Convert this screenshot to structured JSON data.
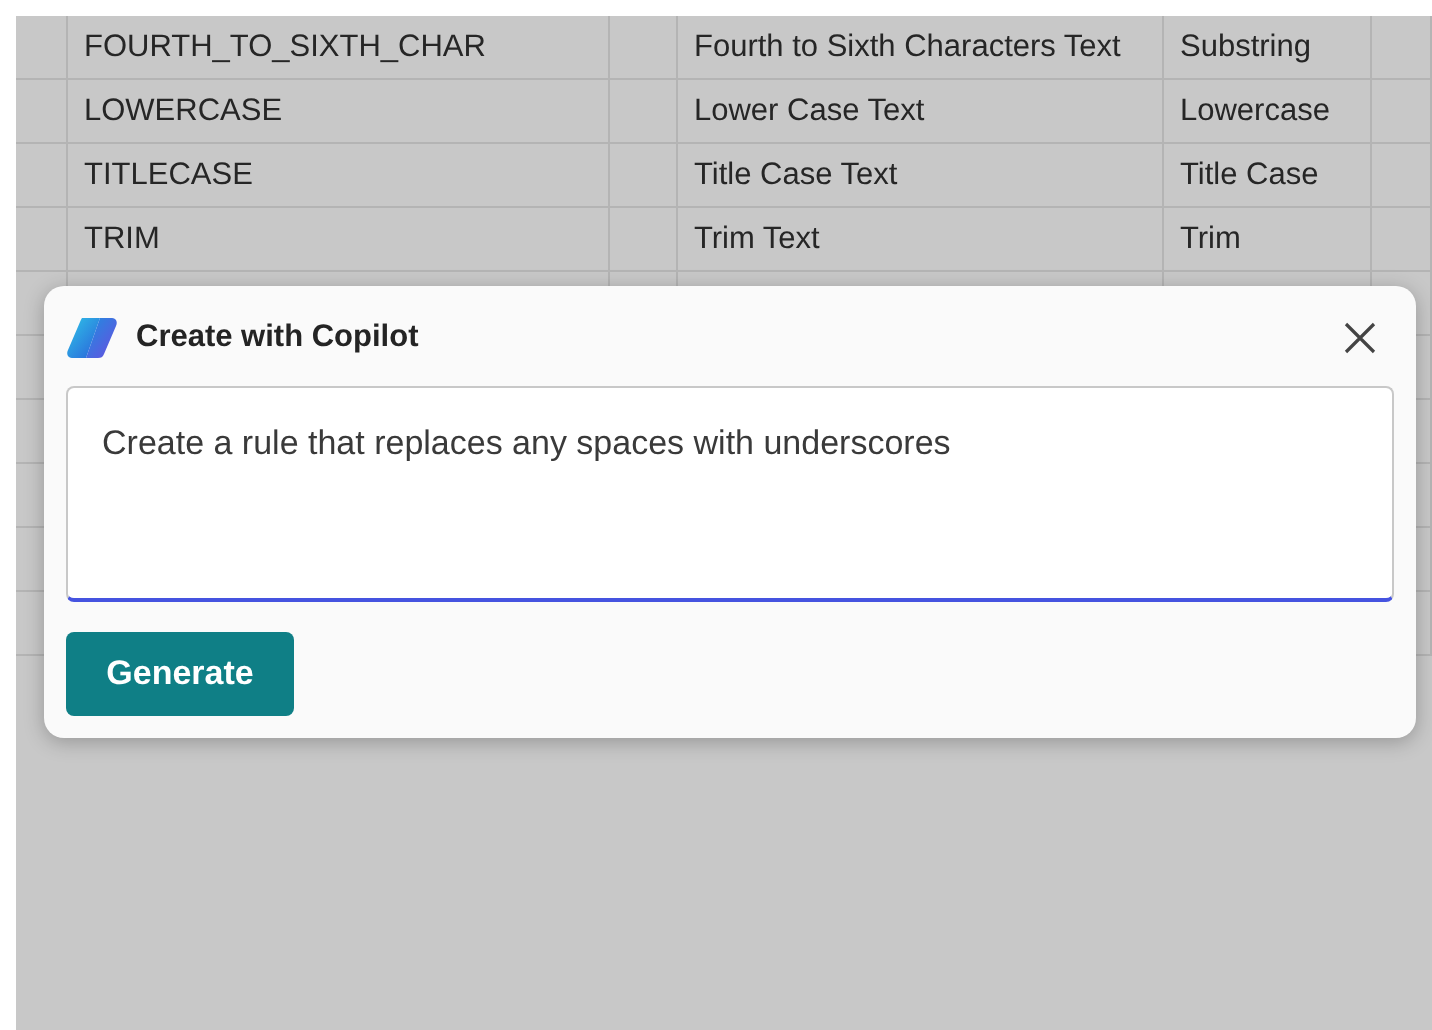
{
  "table": {
    "rows": [
      {
        "column_2": "FOURTH_TO_SIXTH_CHAR",
        "column_4": "Fourth to Sixth Characters Text",
        "column_5": "Substring"
      },
      {
        "column_2": "LOWERCASE",
        "column_4": "Lower Case Text",
        "column_5": "Lowercase"
      },
      {
        "column_2": "TITLECASE",
        "column_4": "Title Case Text",
        "column_5": "Title Case"
      },
      {
        "column_2": "TRIM",
        "column_4": "Trim Text",
        "column_5": "Trim"
      }
    ]
  },
  "dialog": {
    "title": "Create with Copilot",
    "prompt": {
      "value": "Create a rule that replaces any spaces with underscores",
      "focused": true
    },
    "button": "Generate"
  }
}
